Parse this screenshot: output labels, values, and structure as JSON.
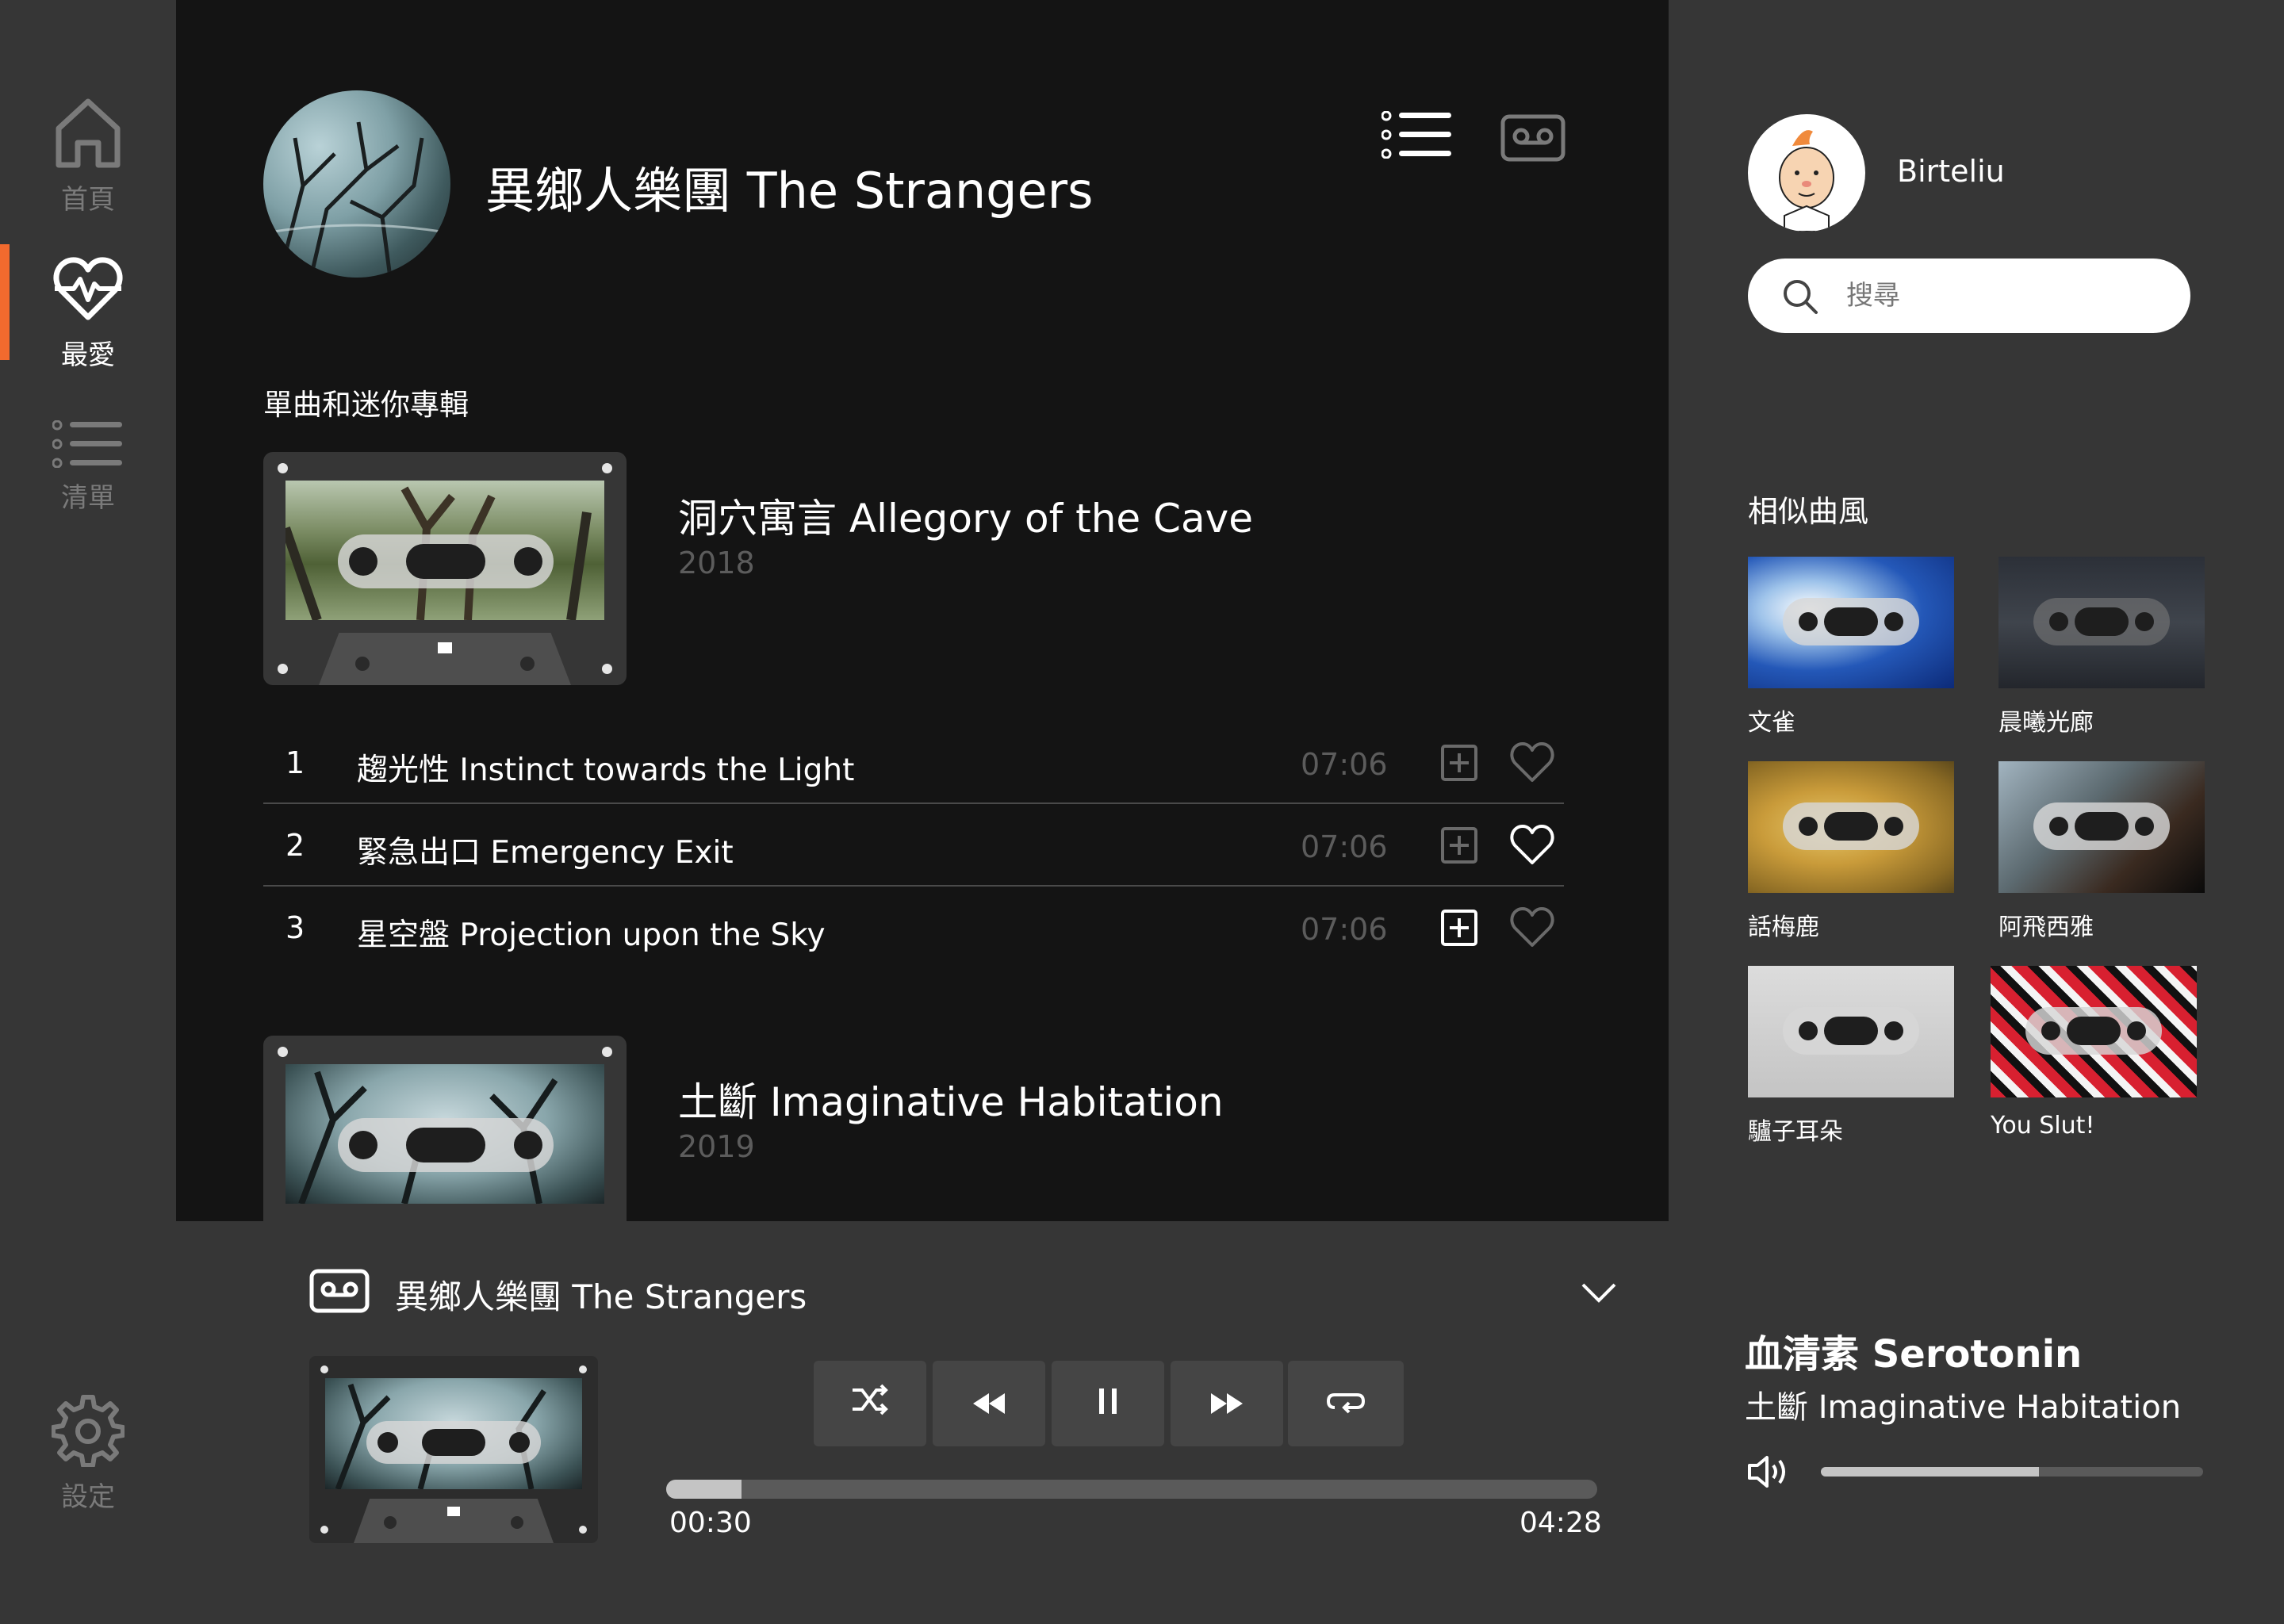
{
  "nav": {
    "home": "首頁",
    "favorites": "最愛",
    "playlist": "清單",
    "settings": "設定"
  },
  "artist": {
    "name": "異鄉人樂團 The Strangers"
  },
  "section_title": "單曲和迷你專輯",
  "albums": [
    {
      "name": "洞穴寓言 Allegory of the Cave",
      "year": "2018"
    },
    {
      "name": "土斷 Imaginative Habitation",
      "year": "2019"
    }
  ],
  "tracks": [
    {
      "num": "1",
      "title": "趨光性 Instinct towards the Light",
      "duration": "07:06",
      "favorited": false
    },
    {
      "num": "2",
      "title": "緊急出口 Emergency Exit",
      "duration": "07:06",
      "favorited": true
    },
    {
      "num": "3",
      "title": "星空盤 Projection upon the Sky",
      "duration": "07:06",
      "favorited": false
    }
  ],
  "user": {
    "name": "Birteliu"
  },
  "search": {
    "placeholder": "搜尋"
  },
  "similar": {
    "title": "相似曲風",
    "items": [
      {
        "label": "文雀"
      },
      {
        "label": "晨曦光廊"
      },
      {
        "label": "話梅鹿"
      },
      {
        "label": "阿飛西雅"
      },
      {
        "label": "驢子耳朵"
      },
      {
        "label": "You Slut!"
      }
    ]
  },
  "player": {
    "artist": "異鄉人樂團 The Strangers",
    "song": "血清素 Serotonin",
    "album": "土斷 Imaginative Habitation",
    "elapsed": "00:30",
    "total": "04:28",
    "progress_fraction": 0.081,
    "volume_fraction": 0.57
  },
  "colors": {
    "accent": "#f26a2e",
    "panel": "#141414",
    "background": "#363636"
  },
  "icons": {
    "nav": [
      "home-icon",
      "heart-pulse-icon",
      "list-icon",
      "gear-icon"
    ],
    "header": [
      "list-view-icon",
      "cassette-view-icon"
    ],
    "controls": [
      "shuffle-icon",
      "rewind-icon",
      "pause-icon",
      "fast-forward-icon",
      "repeat-icon"
    ],
    "misc": [
      "search-icon",
      "add-to-playlist-icon",
      "heart-icon",
      "chevron-down-icon",
      "volume-icon"
    ]
  }
}
